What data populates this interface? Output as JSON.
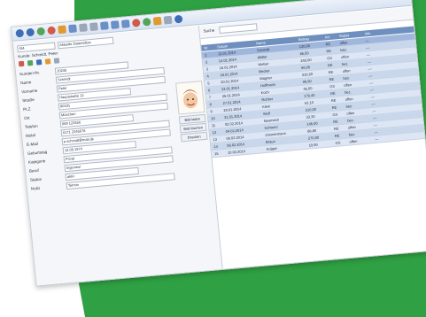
{
  "toolbar": {
    "items": [
      "back",
      "forward",
      "refresh",
      "stop",
      "home",
      "search",
      "save",
      "print",
      "cut",
      "copy",
      "paste",
      "delete",
      "new",
      "open",
      "settings",
      "help"
    ]
  },
  "form": {
    "search_value": "SM",
    "dropdown_1": "Aktuelle Datensätze",
    "header_label": "Kunde: Schmidt, Peter",
    "fields": [
      {
        "label": "Kunden-Nr.",
        "value": "10245"
      },
      {
        "label": "Name",
        "value": "Schmidt"
      },
      {
        "label": "Vorname",
        "value": "Peter"
      },
      {
        "label": "Straße",
        "value": "Hauptstraße 12"
      },
      {
        "label": "PLZ",
        "value": "80331"
      },
      {
        "label": "Ort",
        "value": "München"
      },
      {
        "label": "Telefon",
        "value": "089 123456"
      },
      {
        "label": "Mobil",
        "value": "0171 2345678"
      },
      {
        "label": "E-Mail",
        "value": "p.schmidt@mail.de"
      },
      {
        "label": "Geburtstag",
        "value": "12.05.1974"
      },
      {
        "label": "Kategorie",
        "value": "Privat"
      },
      {
        "label": "Beruf",
        "value": "Ingenieur"
      },
      {
        "label": "Status",
        "value": "aktiv"
      },
      {
        "label": "Notiz",
        "value": "Termin"
      }
    ],
    "side_buttons": [
      "Bild laden",
      "Bild löschen",
      "Drucken"
    ]
  },
  "grid": {
    "top_label": "Suche",
    "columns": [
      "Nr.",
      "Datum",
      "Name",
      "Betrag",
      "Art",
      "Status",
      "Info"
    ],
    "rows": [
      [
        "1",
        "12.01.2014",
        "Schmidt",
        "120,00",
        "RE",
        "offen",
        "—"
      ],
      [
        "2",
        "14.01.2014",
        "Müller",
        "85,50",
        "RE",
        "bez.",
        "—"
      ],
      [
        "3",
        "15.01.2014",
        "Weber",
        "240,00",
        "GS",
        "offen",
        "—"
      ],
      [
        "4",
        "18.01.2014",
        "Becker",
        "56,00",
        "RE",
        "bez.",
        "—"
      ],
      [
        "5",
        "20.01.2014",
        "Wagner",
        "310,20",
        "RE",
        "offen",
        "—"
      ],
      [
        "6",
        "22.01.2014",
        "Hoffmann",
        "99,90",
        "RE",
        "bez.",
        "—"
      ],
      [
        "7",
        "25.01.2014",
        "Koch",
        "45,00",
        "GS",
        "offen",
        "—"
      ],
      [
        "8",
        "27.01.2014",
        "Richter",
        "178,40",
        "RE",
        "bez.",
        "—"
      ],
      [
        "9",
        "29.01.2014",
        "Klein",
        "62,10",
        "RE",
        "offen",
        "—"
      ],
      [
        "10",
        "31.01.2014",
        "Wolf",
        "210,00",
        "RE",
        "bez.",
        "—"
      ],
      [
        "11",
        "02.02.2014",
        "Neumann",
        "33,30",
        "GS",
        "offen",
        "—"
      ],
      [
        "12",
        "04.02.2014",
        "Schwarz",
        "145,00",
        "RE",
        "bez.",
        "—"
      ],
      [
        "13",
        "06.02.2014",
        "Zimmermann",
        "88,80",
        "RE",
        "offen",
        "—"
      ],
      [
        "14",
        "08.02.2014",
        "Braun",
        "270,00",
        "RE",
        "bez.",
        "—"
      ],
      [
        "15",
        "10.02.2014",
        "Krüger",
        "19,90",
        "GS",
        "offen",
        "—"
      ]
    ]
  },
  "colors": {
    "green": "#2fa043",
    "grid_header": "#6f8fbf",
    "row_alt": "#c9d7ec",
    "row_sel": "#9fb7dd"
  }
}
